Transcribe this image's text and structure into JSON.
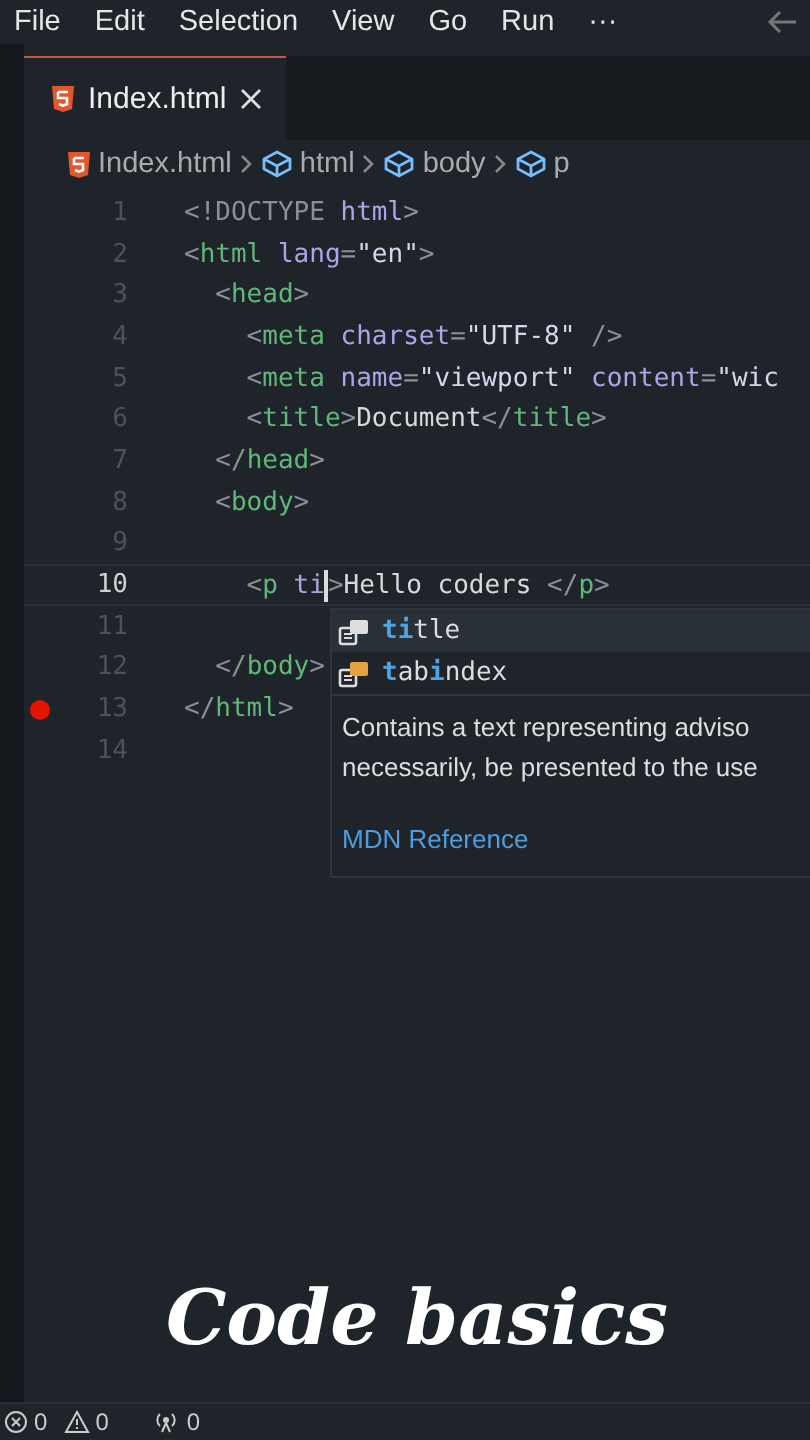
{
  "menu": [
    "File",
    "Edit",
    "Selection",
    "View",
    "Go",
    "Run",
    "···"
  ],
  "tabs": [
    {
      "label": "Index.html",
      "selected": true
    }
  ],
  "breadcrumbs": [
    {
      "kind": "file",
      "label": "Index.html"
    },
    {
      "kind": "symbol",
      "label": "html"
    },
    {
      "kind": "symbol",
      "label": "body"
    },
    {
      "kind": "symbol",
      "label": "p"
    }
  ],
  "lines": [
    {
      "number": "1",
      "current": false,
      "breakpoint": false,
      "tokens": [
        {
          "kind": "punct",
          "text": "<!DOCTYPE "
        },
        {
          "kind": "attr",
          "text": "html"
        },
        {
          "kind": "punct",
          "text": ">"
        }
      ]
    },
    {
      "number": "2",
      "current": false,
      "breakpoint": false,
      "tokens": [
        {
          "kind": "punct",
          "text": "<"
        },
        {
          "kind": "tag",
          "text": "html"
        },
        {
          "kind": "attr",
          "text": " lang"
        },
        {
          "kind": "punct",
          "text": "="
        },
        {
          "kind": "string",
          "text": "\"en\""
        },
        {
          "kind": "punct",
          "text": ">"
        }
      ]
    },
    {
      "number": "3",
      "current": false,
      "breakpoint": false,
      "tokens": [
        {
          "kind": "punct",
          "text": "  <"
        },
        {
          "kind": "tag",
          "text": "head"
        },
        {
          "kind": "punct",
          "text": ">"
        }
      ]
    },
    {
      "number": "4",
      "current": false,
      "breakpoint": false,
      "tokens": [
        {
          "kind": "punct",
          "text": "    <"
        },
        {
          "kind": "tag",
          "text": "meta"
        },
        {
          "kind": "attr",
          "text": " charset"
        },
        {
          "kind": "punct",
          "text": "="
        },
        {
          "kind": "string",
          "text": "\"UTF-8\""
        },
        {
          "kind": "punct",
          "text": " />"
        }
      ]
    },
    {
      "number": "5",
      "current": false,
      "breakpoint": false,
      "tokens": [
        {
          "kind": "punct",
          "text": "    <"
        },
        {
          "kind": "tag",
          "text": "meta"
        },
        {
          "kind": "attr",
          "text": " name"
        },
        {
          "kind": "punct",
          "text": "="
        },
        {
          "kind": "string",
          "text": "\"viewport\""
        },
        {
          "kind": "attr",
          "text": " content"
        },
        {
          "kind": "punct",
          "text": "="
        },
        {
          "kind": "string",
          "text": "\"wic"
        }
      ]
    },
    {
      "number": "6",
      "current": false,
      "breakpoint": false,
      "tokens": [
        {
          "kind": "punct",
          "text": "    <"
        },
        {
          "kind": "tag",
          "text": "title"
        },
        {
          "kind": "punct",
          "text": ">"
        },
        {
          "kind": "text",
          "text": "Document"
        },
        {
          "kind": "punct",
          "text": "</"
        },
        {
          "kind": "tag",
          "text": "title"
        },
        {
          "kind": "punct",
          "text": ">"
        }
      ]
    },
    {
      "number": "7",
      "current": false,
      "breakpoint": false,
      "tokens": [
        {
          "kind": "punct",
          "text": "  </"
        },
        {
          "kind": "tag",
          "text": "head"
        },
        {
          "kind": "punct",
          "text": ">"
        }
      ]
    },
    {
      "number": "8",
      "current": false,
      "breakpoint": false,
      "tokens": [
        {
          "kind": "punct",
          "text": "  <"
        },
        {
          "kind": "tag",
          "text": "body"
        },
        {
          "kind": "punct",
          "text": ">"
        }
      ]
    },
    {
      "number": "9",
      "current": false,
      "breakpoint": false
    },
    {
      "number": "10",
      "current": true,
      "breakpoint": false,
      "tokens": [
        {
          "kind": "punct",
          "text": "    <"
        },
        {
          "kind": "tag",
          "text": "p"
        },
        {
          "kind": "attr",
          "text": " ti"
        },
        {
          "kind": "caret"
        },
        {
          "kind": "punct",
          "text": ">"
        },
        {
          "kind": "text",
          "text": "Hello coders "
        },
        {
          "kind": "punct",
          "text": "</"
        },
        {
          "kind": "tag",
          "text": "p"
        },
        {
          "kind": "punct",
          "text": ">"
        }
      ]
    },
    {
      "number": "11",
      "current": false,
      "breakpoint": false
    },
    {
      "number": "12",
      "current": false,
      "breakpoint": false,
      "tokens": [
        {
          "kind": "punct",
          "text": "  </"
        },
        {
          "kind": "tag",
          "text": "body"
        },
        {
          "kind": "punct",
          "text": ">"
        }
      ]
    },
    {
      "number": "13",
      "current": false,
      "breakpoint": true,
      "tokens": [
        {
          "kind": "punct",
          "text": "</"
        },
        {
          "kind": "tag",
          "text": "html"
        },
        {
          "kind": "punct",
          "text": ">"
        }
      ]
    },
    {
      "number": "14",
      "current": false,
      "breakpoint": false
    }
  ],
  "suggestions": [
    {
      "selected": true,
      "parts": [
        {
          "kind": "match",
          "text": "ti"
        },
        {
          "kind": "rest",
          "text": "tle"
        }
      ]
    },
    {
      "selected": false,
      "parts": [
        {
          "kind": "match",
          "text": "t"
        },
        {
          "kind": "rest",
          "text": "ab"
        },
        {
          "kind": "match",
          "text": "i"
        },
        {
          "kind": "rest",
          "text": "ndex"
        }
      ]
    }
  ],
  "doc": {
    "text": [
      "Contains a text representing adviso",
      "necessarily, be presented to the use"
    ],
    "link": "MDN Reference"
  },
  "caption": "Code basics",
  "status": [
    {
      "kind": "errors",
      "count": "0"
    },
    {
      "kind": "warnings",
      "count": "0"
    },
    {
      "kind": "ports",
      "count": "0"
    }
  ]
}
